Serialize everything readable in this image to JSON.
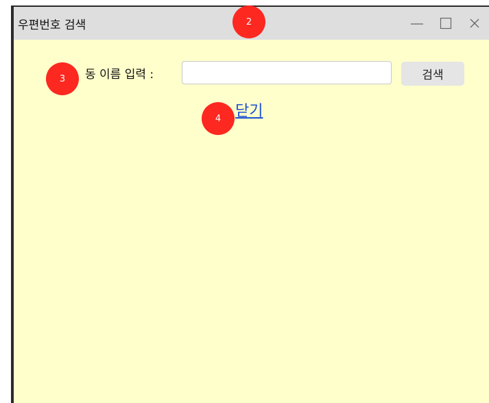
{
  "window": {
    "title": "우편번호 검색"
  },
  "titlebar_icons": {
    "minimize": "minimize-icon",
    "maximize": "maximize-icon",
    "close": "close-icon"
  },
  "search": {
    "label": "동 이름 입력 :",
    "input_value": "",
    "button_label": "검색"
  },
  "close_link": "닫기",
  "annotations": {
    "badge_2": "2",
    "badge_3": "3",
    "badge_4": "4",
    "color": "#fd2820"
  },
  "colors": {
    "content_background": "#ffffcc",
    "titlebar_background": "#dedede",
    "link": "#1a4fd0"
  }
}
